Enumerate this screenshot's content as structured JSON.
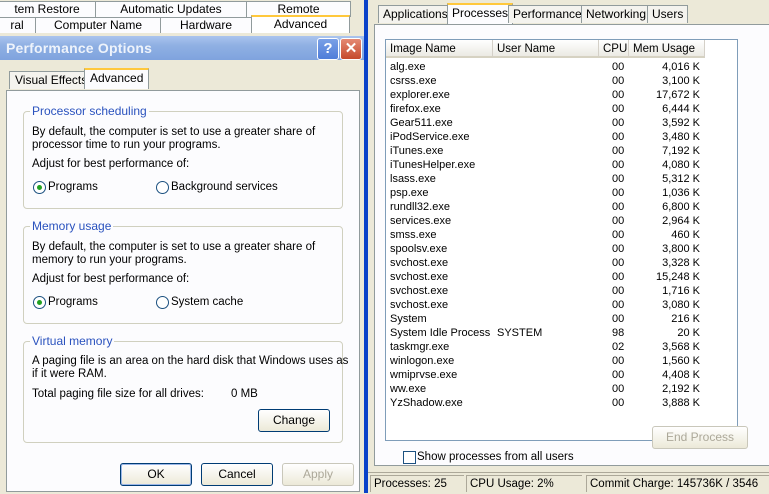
{
  "system_properties": {
    "tabs_row1": [
      "tem Restore",
      "Automatic Updates",
      "Remote"
    ],
    "tabs_row2": [
      "ral",
      "Computer Name",
      "Hardware",
      "Advanced"
    ]
  },
  "performance_options": {
    "title": "Performance Options",
    "tabs": [
      "Visual Effects",
      "Advanced"
    ],
    "processor": {
      "label": "Processor scheduling",
      "desc1": "By default, the computer is set to use a greater share of",
      "desc2": "processor time to run your programs.",
      "adjust": "Adjust for best performance of:",
      "opt1": "Programs",
      "opt2": "Background services"
    },
    "memory": {
      "label": "Memory usage",
      "desc1": "By default, the computer is set to use a greater share of",
      "desc2": "memory to run your programs.",
      "adjust": "Adjust for best performance of:",
      "opt1": "Programs",
      "opt2": "System cache"
    },
    "virtual": {
      "label": "Virtual memory",
      "desc1": "A paging file is an area on the hard disk that Windows uses as",
      "desc2": "if it were RAM.",
      "total_label": "Total paging file size for all drives:",
      "total_value": "0 MB",
      "change": "Change"
    },
    "buttons": {
      "ok": "OK",
      "cancel": "Cancel",
      "apply": "Apply"
    }
  },
  "task_manager": {
    "tabs": [
      "Applications",
      "Processes",
      "Performance",
      "Networking",
      "Users"
    ],
    "columns": [
      "Image Name",
      "User Name",
      "CPU",
      "Mem Usage"
    ],
    "processes": [
      [
        "alg.exe",
        "",
        "00",
        "4,016 K"
      ],
      [
        "csrss.exe",
        "",
        "00",
        "3,100 K"
      ],
      [
        "explorer.exe",
        "",
        "00",
        "17,672 K"
      ],
      [
        "firefox.exe",
        "",
        "00",
        "6,444 K"
      ],
      [
        "Gear511.exe",
        "",
        "00",
        "3,592 K"
      ],
      [
        "iPodService.exe",
        "",
        "00",
        "3,480 K"
      ],
      [
        "iTunes.exe",
        "",
        "00",
        "7,192 K"
      ],
      [
        "iTunesHelper.exe",
        "",
        "00",
        "4,080 K"
      ],
      [
        "lsass.exe",
        "",
        "00",
        "5,312 K"
      ],
      [
        "psp.exe",
        "",
        "00",
        "1,036 K"
      ],
      [
        "rundll32.exe",
        "",
        "00",
        "6,800 K"
      ],
      [
        "services.exe",
        "",
        "00",
        "2,964 K"
      ],
      [
        "smss.exe",
        "",
        "00",
        "460 K"
      ],
      [
        "spoolsv.exe",
        "",
        "00",
        "3,800 K"
      ],
      [
        "svchost.exe",
        "",
        "00",
        "3,328 K"
      ],
      [
        "svchost.exe",
        "",
        "00",
        "15,248 K"
      ],
      [
        "svchost.exe",
        "",
        "00",
        "1,716 K"
      ],
      [
        "svchost.exe",
        "",
        "00",
        "3,080 K"
      ],
      [
        "System",
        "",
        "00",
        "216 K"
      ],
      [
        "System Idle Process",
        "SYSTEM",
        "98",
        "20 K"
      ],
      [
        "taskmgr.exe",
        "",
        "02",
        "3,568 K"
      ],
      [
        "winlogon.exe",
        "",
        "00",
        "1,560 K"
      ],
      [
        "wmiprvse.exe",
        "",
        "00",
        "4,408 K"
      ],
      [
        "ww.exe",
        "",
        "00",
        "2,192 K"
      ],
      [
        "YzShadow.exe",
        "",
        "00",
        "3,888 K"
      ]
    ],
    "show_all_label": "Show processes from all users",
    "end_process": "End Process",
    "status": {
      "processes": "Processes: 25",
      "cpu": "CPU Usage: 2%",
      "commit": "Commit Charge: 145736K / 3546"
    }
  }
}
